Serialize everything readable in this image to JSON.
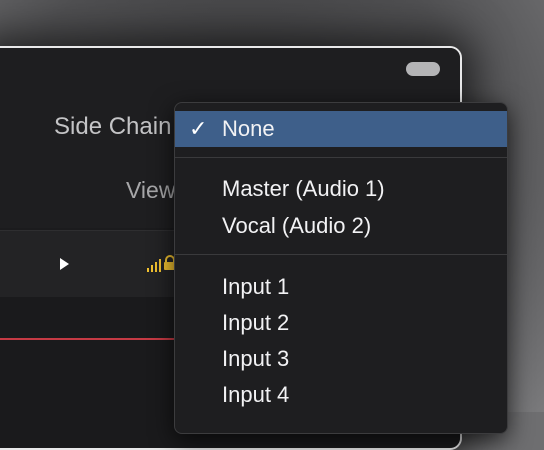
{
  "plugin": {
    "sidechain_label": "Side Chain",
    "view_label": "View"
  },
  "menu": {
    "selected": {
      "label": "None",
      "check": "✓"
    },
    "tracks": [
      {
        "label": "Master (Audio 1)"
      },
      {
        "label": "Vocal (Audio 2)"
      }
    ],
    "inputs": [
      {
        "label": "Input 1"
      },
      {
        "label": "Input 2"
      },
      {
        "label": "Input 3"
      },
      {
        "label": "Input 4"
      }
    ]
  },
  "colors": {
    "selection": "#3e5f8a",
    "accent_yellow": "#f2c230",
    "playhead_red": "#c63a44"
  },
  "icons": [
    "play-icon",
    "level-icon",
    "lock-icon",
    "checkmark-icon"
  ]
}
